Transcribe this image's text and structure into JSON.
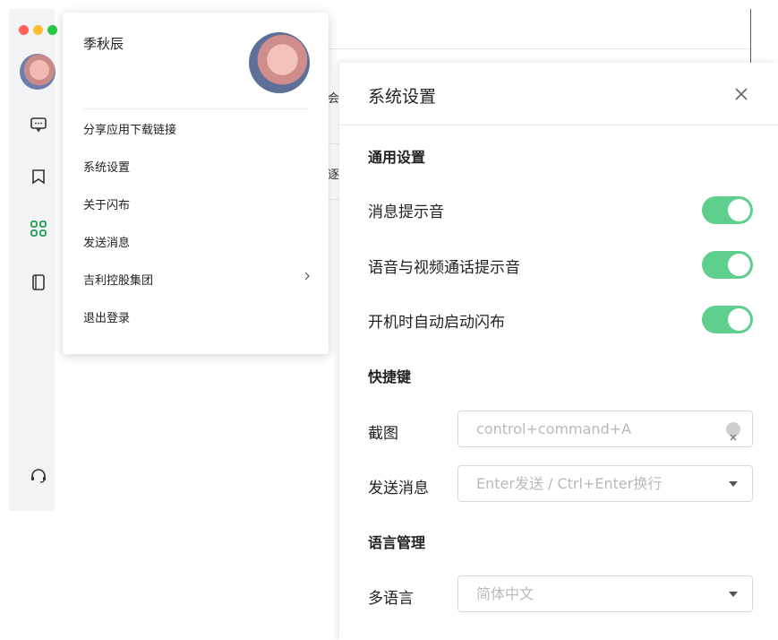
{
  "popup": {
    "name": "季秋辰",
    "menu": [
      {
        "label": "分享应用下载链接"
      },
      {
        "label": "系统设置"
      },
      {
        "label": "关于闪布"
      },
      {
        "label": "发送消息"
      },
      {
        "label": "吉利控股集团",
        "has_submenu": true
      },
      {
        "label": "退出登录"
      }
    ]
  },
  "background": {
    "peek_1": "会话",
    "peek_2": "逐帧"
  },
  "settings": {
    "title": "系统设置",
    "general": {
      "title": "通用设置",
      "rows": [
        {
          "label": "消息提示音",
          "on": true
        },
        {
          "label": "语音与视频通话提示音",
          "on": true
        },
        {
          "label": "开机时自动启动闪布",
          "on": true
        }
      ]
    },
    "shortcuts": {
      "title": "快捷键",
      "screenshot_label": "截图",
      "screenshot_value": "control+command+A",
      "send_label": "发送消息",
      "send_value": "Enter发送 / Ctrl+Enter换行"
    },
    "language": {
      "title": "语言管理",
      "label": "多语言",
      "value": "简体中文"
    }
  },
  "colors": {
    "toggle_on": "#5fcf8e",
    "accent_icon": "#1f9d55",
    "traffic_red": "#ff5f57",
    "traffic_yellow": "#febc2e",
    "traffic_green": "#28c840"
  }
}
